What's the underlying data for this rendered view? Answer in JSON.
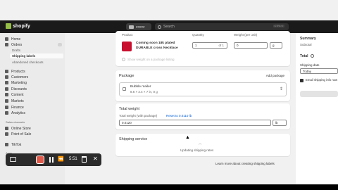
{
  "topbar": {
    "logo": "shopify",
    "store": "#####",
    "search_placeholder": "Search",
    "search_shortcut": "CTRL K"
  },
  "sidebar": {
    "home": "Home",
    "orders": "Orders",
    "drafts": "Drafts",
    "shipping_labels": "Shipping labels",
    "abandoned_checkouts": "Abandoned checkouts",
    "products": "Products",
    "customers": "Customers",
    "marketing": "Marketing",
    "discounts": "Discounts",
    "content": "Content",
    "markets": "Markets",
    "finance": "Finance",
    "analytics": "Analytics",
    "sales_channels": "Sales channels",
    "online_store": "Online Store",
    "point_of_sale": "Point of Sale",
    "tiktok": "TikTok",
    "apps": "Apps"
  },
  "items_card": {
    "col_product": "Product",
    "col_quantity": "Quantity",
    "col_weight": "Weight (per unit)",
    "product_name_line1": "Coming soon 18k plated",
    "product_name_line2": "DURABLE cross Necklace",
    "quantity_value": "1",
    "quantity_total": "of 1",
    "weight_value": "0",
    "weight_unit": "g",
    "label_note": "Show weight on a package listing"
  },
  "package_card": {
    "title": "Package",
    "add_package": "Add package",
    "package_name": "Bubble mailer",
    "package_dims": "8.6 × 2.4 × 7 in, 0 g"
  },
  "weight_card": {
    "title": "Total weight",
    "subtitle": "Total weight (with package)",
    "reset_link": "Reset to 0.0110 lb",
    "value": "0.0120",
    "unit": "lb"
  },
  "shipping_card": {
    "title": "Shipping service",
    "updating": "Updating shipping rates"
  },
  "footer_link": "Learn more about creating shipping labels",
  "summary": {
    "title": "Summary",
    "subtotal": "Subtotal",
    "total": "Total",
    "shipping_date_label": "Shipping date",
    "shipping_date_value": "Today",
    "email_label": "Email shipping info now"
  },
  "recorder": {
    "time": "5:51"
  }
}
